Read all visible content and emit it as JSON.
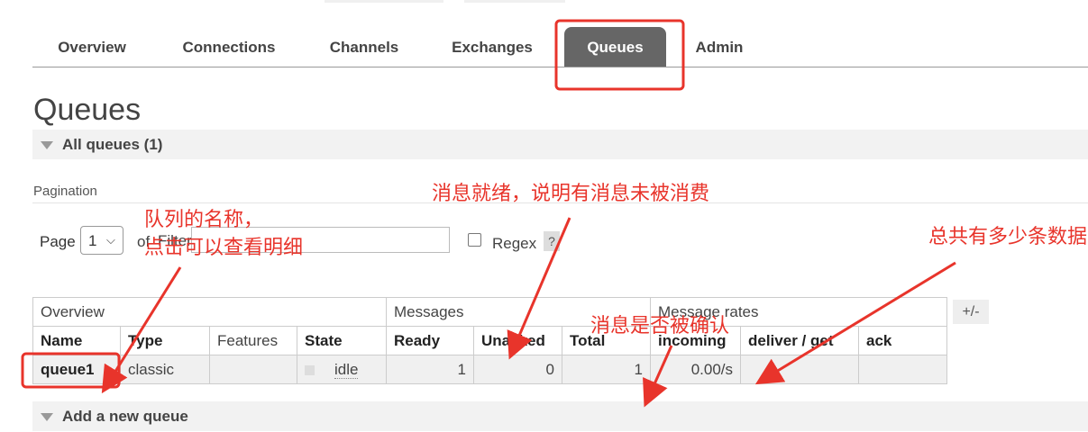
{
  "nav": {
    "tabs": [
      "Overview",
      "Connections",
      "Channels",
      "Exchanges",
      "Queues",
      "Admin"
    ],
    "active": "Queues"
  },
  "page_title": "Queues",
  "all_queues": {
    "label": "All queues (1)"
  },
  "pagination": {
    "label": "Pagination",
    "page_label": "Page",
    "page_value": "1",
    "of_label": "of",
    "filter_label": "Filter:",
    "regex_label": "Regex",
    "help_label": "?"
  },
  "table": {
    "group_headers": [
      "Overview",
      "Messages",
      "Message rates"
    ],
    "plus_minus": "+/-",
    "columns": [
      "Name",
      "Type",
      "Features",
      "State",
      "Ready",
      "Unacked",
      "Total",
      "incoming",
      "deliver / get",
      "ack"
    ],
    "row": {
      "name": "queue1",
      "type": "classic",
      "features": "",
      "state": "idle",
      "ready": "1",
      "unacked": "0",
      "total": "1",
      "incoming": "0.00/s",
      "deliver_get": "",
      "ack": ""
    }
  },
  "add_queue": {
    "label": "Add a new queue"
  },
  "annotations": {
    "name_note_line1": "队列的名称，",
    "name_note_line2": "点击可以查看明细",
    "ready_note": "消息就绪，说明有消息未被消费",
    "unacked_note": "消息是否被确认",
    "total_note": "总共有多少条数据"
  },
  "colors": {
    "annotation": "#e8342b",
    "active_tab": "#666666"
  }
}
